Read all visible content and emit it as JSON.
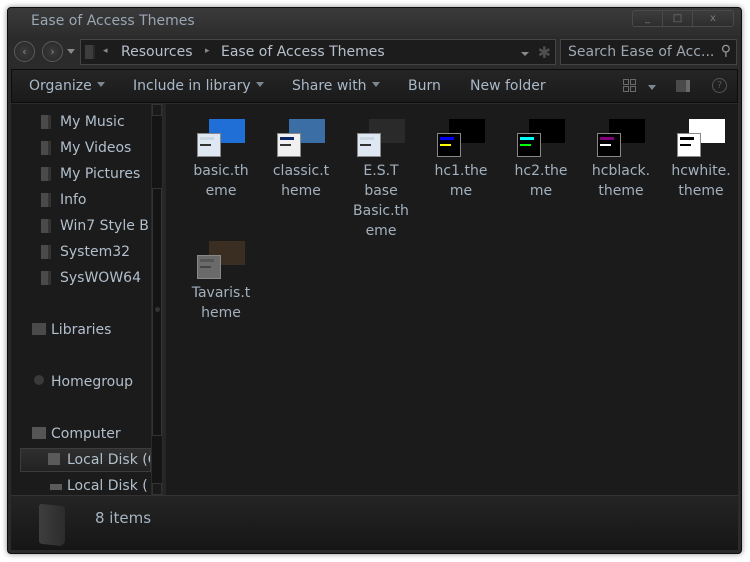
{
  "window": {
    "title": "Ease of Access Themes",
    "controls": {
      "minimize": "_",
      "maximize": "□",
      "close": "x"
    }
  },
  "nav": {
    "back_icon": "‹",
    "forward_icon": "›",
    "breadcrumb": [
      "Resources",
      "Ease of Access Themes"
    ],
    "crumb_sep": "▸",
    "root_sep": "◂",
    "refresh_icon": "✱",
    "search_placeholder": "Search Ease of Acc...",
    "search_icon": "⚲"
  },
  "toolbar": {
    "organize": "Organize",
    "include_in_library": "Include in library",
    "share_with": "Share with",
    "burn": "Burn",
    "new_folder": "New folder",
    "help": "?"
  },
  "sidebar": {
    "items": [
      {
        "label": "My Music",
        "icon": "music-folder-icon"
      },
      {
        "label": "My Videos",
        "icon": "videos-folder-icon"
      },
      {
        "label": "My Pictures",
        "icon": "pictures-folder-icon"
      },
      {
        "label": "Info",
        "icon": "folder-icon"
      },
      {
        "label": "Win7 Style B",
        "icon": "folder-icon"
      },
      {
        "label": "System32",
        "icon": "folder-icon"
      },
      {
        "label": "SysWOW64",
        "icon": "folder-icon"
      },
      {
        "label": "Libraries",
        "icon": "libraries-icon"
      },
      {
        "label": "Homegroup",
        "icon": "homegroup-icon"
      },
      {
        "label": "Computer",
        "icon": "computer-icon"
      },
      {
        "label": "Local Disk (C",
        "icon": "drive-icon",
        "selected": true
      },
      {
        "label": "Local Disk (E:",
        "icon": "drive-icon"
      }
    ]
  },
  "files": [
    {
      "name": "basic.theme",
      "line1": "basic.th",
      "line2": "eme",
      "bg": "#1f6fd6",
      "titlebar": "#c9d6e4",
      "bar2": "#333333",
      "win": "#dfe8f2"
    },
    {
      "name": "classic.theme",
      "line1": "classic.t",
      "line2": "heme",
      "bg": "#3a6ea5",
      "titlebar": "#0a246a",
      "bar2": "#333333",
      "win": "#f0f0f0"
    },
    {
      "name": "E.S.T base Basic.theme",
      "line1": "E.S.T",
      "line2": "base",
      "line3": "Basic.th",
      "line4": "eme",
      "bg": "#2a2a2a",
      "titlebar": "#c9d6e4",
      "bar2": "#333333",
      "win": "#dfe8f2"
    },
    {
      "name": "hc1.theme",
      "line1": "hc1.the",
      "line2": "me",
      "bg": "#000000",
      "titlebar": "#0000ff",
      "bar2": "#ffff00",
      "win": "#000000"
    },
    {
      "name": "hc2.theme",
      "line1": "hc2.the",
      "line2": "me",
      "bg": "#000000",
      "titlebar": "#00ffff",
      "bar2": "#00ff00",
      "win": "#000000"
    },
    {
      "name": "hcblack.theme",
      "line1": "hcblack.",
      "line2": "theme",
      "bg": "#000000",
      "titlebar": "#800080",
      "bar2": "#ffffff",
      "win": "#000000"
    },
    {
      "name": "hcwhite.theme",
      "line1": "hcwhite.",
      "line2": "theme",
      "bg": "#ffffff",
      "titlebar": "#000000",
      "bar2": "#000000",
      "win": "#ffffff"
    },
    {
      "name": "Tavaris.theme",
      "line1": "Tavaris.t",
      "line2": "heme",
      "bg": "#3a2e22",
      "titlebar": "#555555",
      "bar2": "#444444",
      "win": "#6a6a6a"
    }
  ],
  "status": {
    "item_count": "8 items"
  }
}
